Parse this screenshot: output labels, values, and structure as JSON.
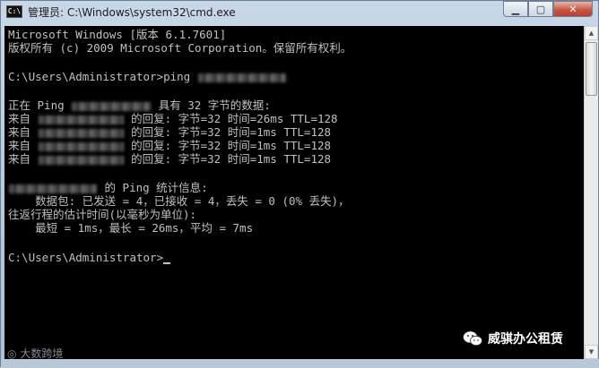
{
  "window": {
    "icon_label": "C:\\",
    "title": "管理员: C:\\Windows\\system32\\cmd.exe",
    "minimize_label": "▁",
    "maximize_label": "▢",
    "close_label": "✕"
  },
  "console": {
    "lines": [
      "Microsoft Windows [版本 6.1.7601]",
      "版权所有 (c) 2009 Microsoft Corporation。保留所有权利。",
      "",
      "C:\\Users\\Administrator>ping",
      "",
      "正在 Ping",
      "具有 32 字节的数据:",
      "来自",
      "的回复: 字节=32 时间=26ms TTL=128",
      "来自",
      "的回复: 字节=32 时间=1ms TTL=128",
      "来自",
      "的回复: 字节=32 时间=1ms TTL=128",
      "来自",
      "的回复: 字节=32 时间=1ms TTL=128",
      "的 Ping 统计信息:",
      "    数据包: 已发送 = 4，已接收 = 4，丢失 = 0 (0% 丢失)，",
      "往返行程的估计时间(以毫秒为单位):",
      "    最短 = 1ms，最长 = 26ms，平均 = 7ms",
      "C:\\Users\\Administrator>"
    ]
  },
  "watermarks": {
    "left": "大数跨境",
    "right": "威骐办公租赁"
  },
  "scrollbar": {
    "up": "▲",
    "down": "▼"
  }
}
